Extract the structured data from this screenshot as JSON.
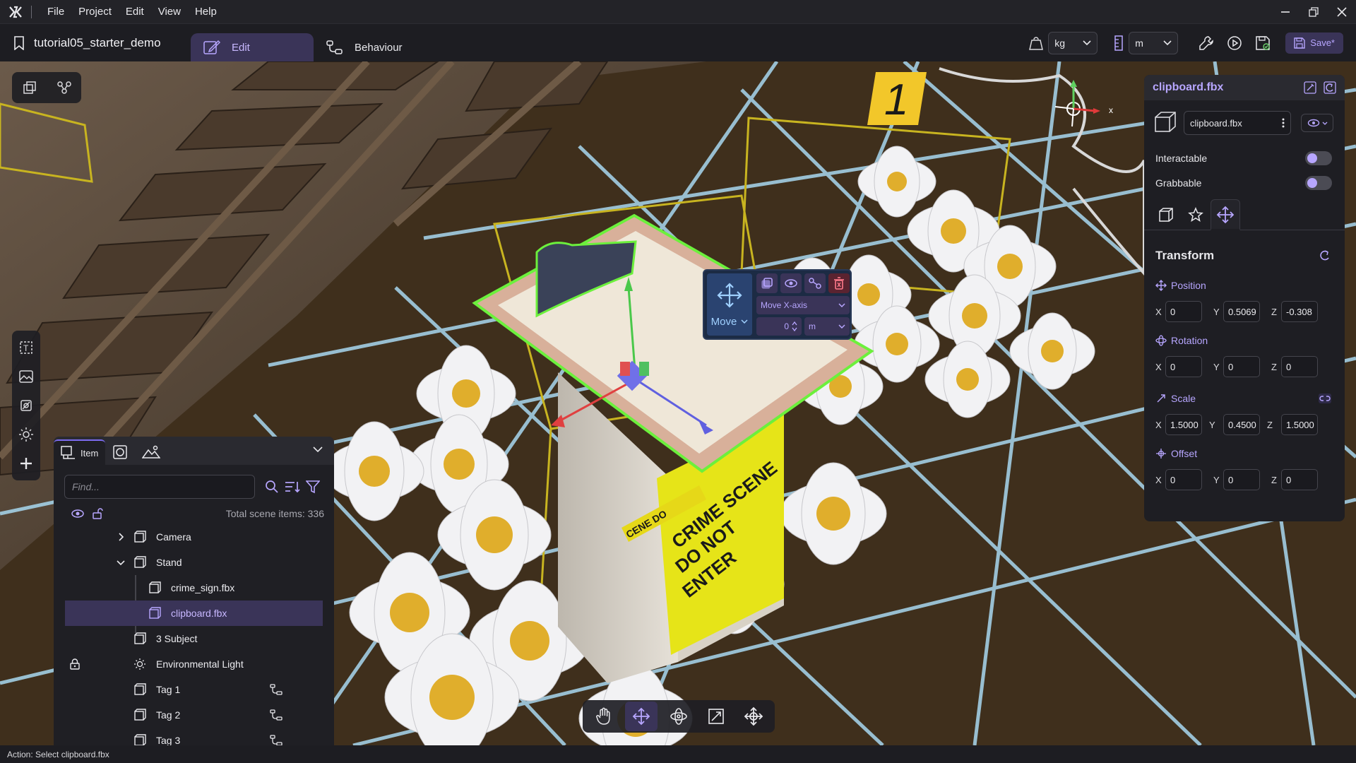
{
  "menubar": {
    "items": [
      "File",
      "Project",
      "Edit",
      "View",
      "Help"
    ]
  },
  "toolbar": {
    "project_name": "tutorial05_starter_demo",
    "tabs": [
      {
        "label": "Edit",
        "active": true
      },
      {
        "label": "Behaviour",
        "active": false
      }
    ],
    "mass_unit": "kg",
    "length_unit": "m",
    "save_label": "Save*"
  },
  "hierarchy": {
    "tabs": [
      {
        "label": "Item",
        "active": true
      }
    ],
    "search_placeholder": "Find...",
    "total_label": "Total scene items: 336",
    "items": [
      {
        "label": "Camera",
        "level": 0,
        "expand": "collapsed",
        "selected": false
      },
      {
        "label": "Stand",
        "level": 0,
        "expand": "expanded",
        "selected": false
      },
      {
        "label": "crime_sign.fbx",
        "level": 1,
        "expand": "none",
        "selected": false
      },
      {
        "label": "clipboard.fbx",
        "level": 1,
        "expand": "none",
        "selected": true
      },
      {
        "label": "3 Subject",
        "level": 0,
        "expand": "none",
        "selected": false
      },
      {
        "label": "Environmental Light",
        "level": 0,
        "expand": "none",
        "selected": false,
        "locked": true
      },
      {
        "label": "Tag 1",
        "level": 0,
        "expand": "none",
        "selected": false,
        "behaviour": true
      },
      {
        "label": "Tag 2",
        "level": 0,
        "expand": "none",
        "selected": false,
        "behaviour": true
      },
      {
        "label": "Tag 3",
        "level": 0,
        "expand": "none",
        "selected": false,
        "behaviour": true
      }
    ]
  },
  "inspector": {
    "title": "clipboard.fbx",
    "object_name": "clipboard.fbx",
    "interactable_label": "Interactable",
    "grabbable_label": "Grabbable",
    "section_title": "Transform",
    "position": {
      "label": "Position",
      "x": "0",
      "y": "0.5069",
      "z": "-0.308"
    },
    "rotation": {
      "label": "Rotation",
      "x": "0",
      "y": "0",
      "z": "0"
    },
    "scale": {
      "label": "Scale",
      "x": "1.5000",
      "y": "0.4500",
      "z": "1.5000"
    },
    "offset": {
      "label": "Offset",
      "x": "0",
      "y": "0",
      "z": "0"
    },
    "axis_labels": {
      "x": "X",
      "y": "Y",
      "z": "Z"
    }
  },
  "move_popup": {
    "mode_label": "Move",
    "axis_option": "Move X-axis",
    "value": "0",
    "unit": "m"
  },
  "scene": {
    "tag_number": "1",
    "axis_x": "x",
    "sign_text_1": "CRIME SCENE",
    "sign_text_2": "DO NOT",
    "sign_text_3": "ENTER",
    "tape_text": "CENE DO"
  },
  "statusbar": {
    "text": "Action: Select clipboard.fbx"
  },
  "colors": {
    "accent": "#7c6cf0",
    "accent_text": "#b7a6ff",
    "selection_bg": "#3a3458",
    "panel_bg": "#1e1e23"
  }
}
